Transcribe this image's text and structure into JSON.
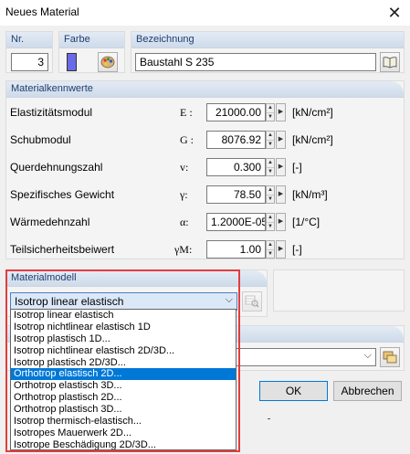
{
  "window": {
    "title": "Neues Material"
  },
  "header": {
    "nr_label": "Nr.",
    "nr_value": "3",
    "farbe_label": "Farbe",
    "color": "#6a6ae8",
    "bezeichnung_label": "Bezeichnung",
    "bezeichnung_value": "Baustahl S 235"
  },
  "kennwerte": {
    "title": "Materialkennwerte",
    "rows": [
      {
        "label": "Elastizitätsmodul",
        "symbol": "E :",
        "value": "21000.00",
        "unit": "[kN/cm²]"
      },
      {
        "label": "Schubmodul",
        "symbol": "G :",
        "value": "8076.92",
        "unit": "[kN/cm²]"
      },
      {
        "label": "Querdehnungszahl",
        "symbol": "v:",
        "value": "0.300",
        "unit": "[-]"
      },
      {
        "label": "Spezifisches Gewicht",
        "symbol": "γ:",
        "value": "78.50",
        "unit": "[kN/m³]"
      },
      {
        "label": "Wärmedehnzahl",
        "symbol": "α:",
        "value": "1.2000E-05",
        "unit": "[1/°C]"
      },
      {
        "label": "Teilsicherheitsbeiwert",
        "symbol": "γM:",
        "value": "1.00",
        "unit": "[-]"
      }
    ]
  },
  "materialmodell": {
    "title": "Materialmodell",
    "selected": "Isotrop linear elastisch",
    "options": [
      "Isotrop linear elastisch",
      "Isotrop nichtlinear elastisch 1D",
      "Isotrop plastisch 1D...",
      "Isotrop nichtlinear elastisch 2D/3D...",
      "Isotrop plastisch 2D/3D...",
      "Orthotrop elastisch 2D...",
      "Orthotrop elastisch 3D...",
      "Orthotrop plastisch 2D...",
      "Orthotrop plastisch 3D...",
      "Isotrop thermisch-elastisch...",
      "Isotropes Mauerwerk 2D...",
      "Isotrope Beschädigung 2D/3D..."
    ],
    "highlighted_index": 5
  },
  "buttons": {
    "ok": "OK",
    "cancel": "Abbrechen"
  }
}
